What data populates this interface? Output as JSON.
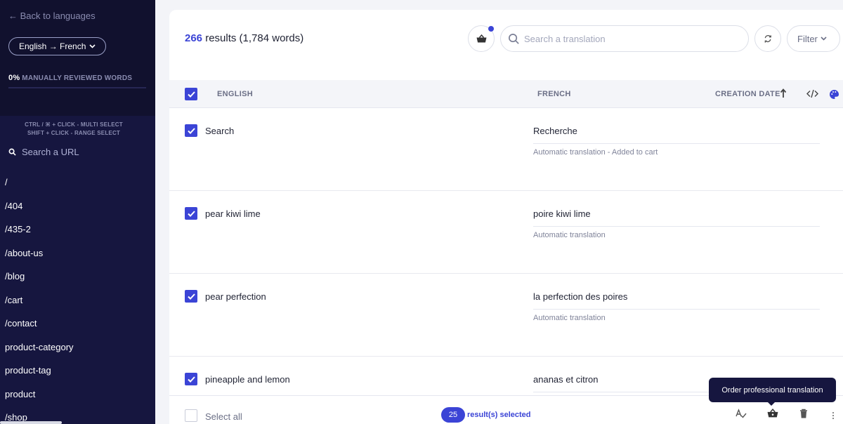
{
  "sidebar": {
    "back_label": "← Back to languages",
    "language_pair": "English → French",
    "reviewed_percent": "0%",
    "reviewed_label": "MANUALLY REVIEWED WORDS",
    "reviewed_progress": 0,
    "hint_multi": "CTRL / ⌘ + CLICK - MULTI SELECT",
    "hint_range": "SHIFT + CLICK - RANGE SELECT",
    "url_search_placeholder": "Search a URL",
    "urls": [
      "/",
      "/404",
      "/435-2",
      "/about-us",
      "/blog",
      "/cart",
      "/contact",
      "product-category",
      "product-tag",
      "product",
      "/shop"
    ]
  },
  "header": {
    "results_count": "266",
    "results_text": "results (1,784 words)",
    "search_placeholder": "Search a translation",
    "filter_label": "Filter"
  },
  "table": {
    "columns": {
      "source": "ENGLISH",
      "target": "FRENCH",
      "date": "CREATION DATE"
    },
    "rows": [
      {
        "source": "Search",
        "target": "Recherche",
        "status": "Automatic translation - Added to cart"
      },
      {
        "source": "pear kiwi lime",
        "target": "poire kiwi lime",
        "status": "Automatic translation"
      },
      {
        "source": "pear perfection",
        "target": "la perfection des poires",
        "status": "Automatic translation"
      },
      {
        "source": "pineapple and lemon",
        "target": "ananas et citron",
        "status": ""
      }
    ]
  },
  "footer": {
    "select_all": "Select all",
    "selected_count": "25",
    "selected_label": "result(s) selected",
    "tooltip": "Order professional translation"
  },
  "colors": {
    "accent": "#3b44d6",
    "sidebar": "#16163f"
  }
}
